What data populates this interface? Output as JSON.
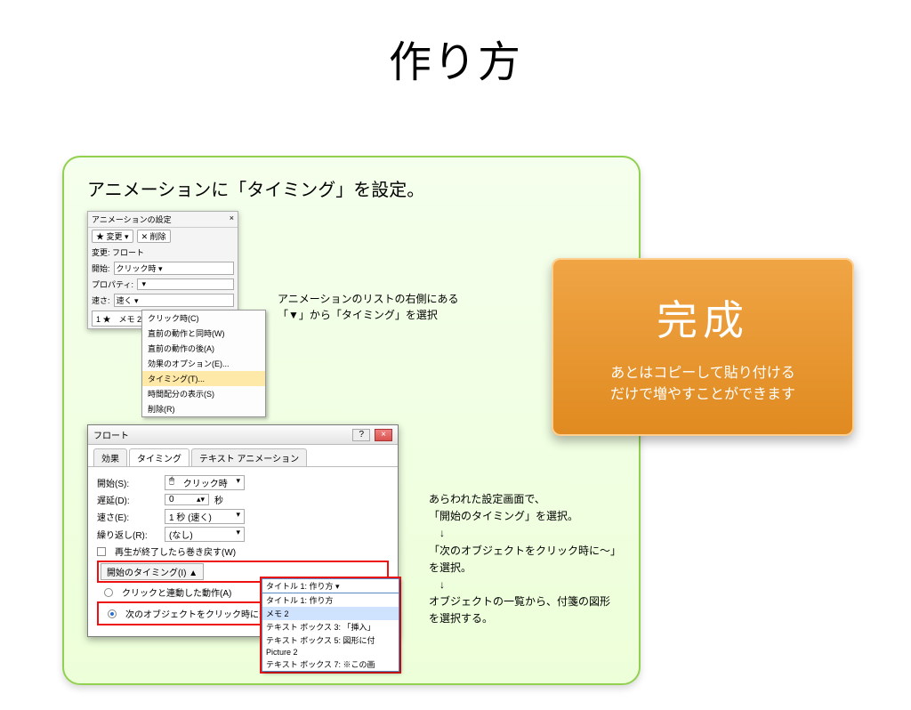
{
  "title": "作り方",
  "card": {
    "heading": "アニメーションに「タイミング」を設定。",
    "caption1_line1": "アニメーションのリストの右側にある",
    "caption1_line2": "「▼」から「タイミング」を選択",
    "caption2_l1": "あらわれた設定画面で、",
    "caption2_l2": "「開始のタイミング」を選択。",
    "caption2_l3": "　↓",
    "caption2_l4": "「次のオブジェクトをクリック時に〜」",
    "caption2_l5": "を選択。",
    "caption2_l6": "　↓",
    "caption2_l7": "オブジェクトの一覧から、付箋の図形",
    "caption2_l8": "を選択する。"
  },
  "pane": {
    "title": "アニメーションの設定",
    "close": "×",
    "btn_change": "変更",
    "btn_remove": "削除",
    "lbl_kind": "変更: フロート",
    "lbl_start": "開始:",
    "val_start": "クリック時",
    "lbl_prop": "プロパティ:",
    "lbl_speed": "速さ:",
    "val_speed": "速く",
    "list_item": "1 ★　メモ 2",
    "menu": [
      "クリック時(C)",
      "直前の動作と同時(W)",
      "直前の動作の後(A)",
      "効果のオプション(E)...",
      "タイミング(T)...",
      "時間配分の表示(S)",
      "削除(R)"
    ],
    "menu_highlight_index": 4
  },
  "dialog": {
    "title": "フロート",
    "tabs": [
      "効果",
      "タイミング",
      "テキスト アニメーション"
    ],
    "active_tab_index": 1,
    "fields": {
      "start_label": "開始(S):",
      "start_value": "クリック時",
      "delay_label": "遅延(D):",
      "delay_value": "0",
      "delay_unit": "秒",
      "speed_label": "速さ(E):",
      "speed_value": "1 秒 (速く)",
      "repeat_label": "繰り返し(R):",
      "repeat_value": "(なし)"
    },
    "chk_rewind": "再生が終了したら巻き戻す(W)",
    "btn_trigger": "開始のタイミング(I) ▲",
    "radio_anim": "クリックと連動した動作(A)",
    "radio_obj": "次のオブジェクトをクリック時に効果を開始(C):",
    "dropdown_selected": "タイトル 1: 作り方",
    "dropdown_items": [
      "タイトル 1: 作り方",
      "メモ 2",
      "テキスト ボックス 3: 「挿入」",
      "テキスト ボックス 5: 図形に付",
      "Picture 2",
      "テキスト ボックス 7: ※この画"
    ],
    "dropdown_highlight_index": 1
  },
  "done": {
    "big": "完成",
    "sub_l1": "あとはコピーして貼り付ける",
    "sub_l2": "だけで増やすことができます"
  }
}
